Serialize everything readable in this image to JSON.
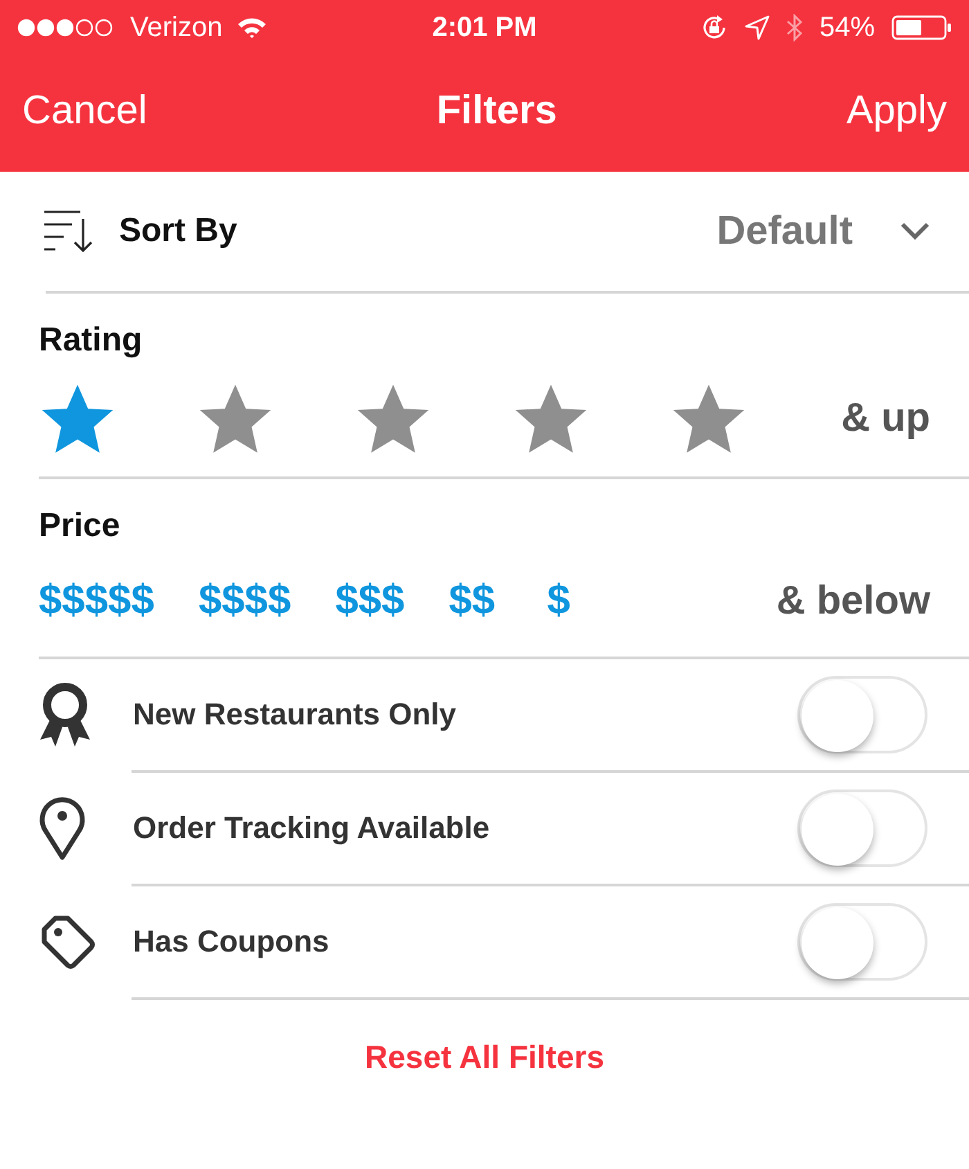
{
  "status_bar": {
    "carrier": "Verizon",
    "time": "2:01 PM",
    "battery": "54%"
  },
  "nav": {
    "cancel": "Cancel",
    "title": "Filters",
    "apply": "Apply"
  },
  "sort": {
    "label": "Sort By",
    "value": "Default"
  },
  "rating": {
    "label": "Rating",
    "stars": 1,
    "suffix": "& up"
  },
  "price": {
    "label": "Price",
    "options": [
      {
        "label": "$$$$$",
        "selected": true
      },
      {
        "label": "$$$$",
        "selected": true
      },
      {
        "label": "$$$",
        "selected": true
      },
      {
        "label": "$$",
        "selected": true
      },
      {
        "label": "$",
        "selected": true
      }
    ],
    "suffix": "& below"
  },
  "toggles": [
    {
      "label": "New Restaurants Only",
      "on": false
    },
    {
      "label": "Order Tracking Available",
      "on": false
    },
    {
      "label": "Has Coupons",
      "on": false
    }
  ],
  "reset": "Reset All Filters"
}
